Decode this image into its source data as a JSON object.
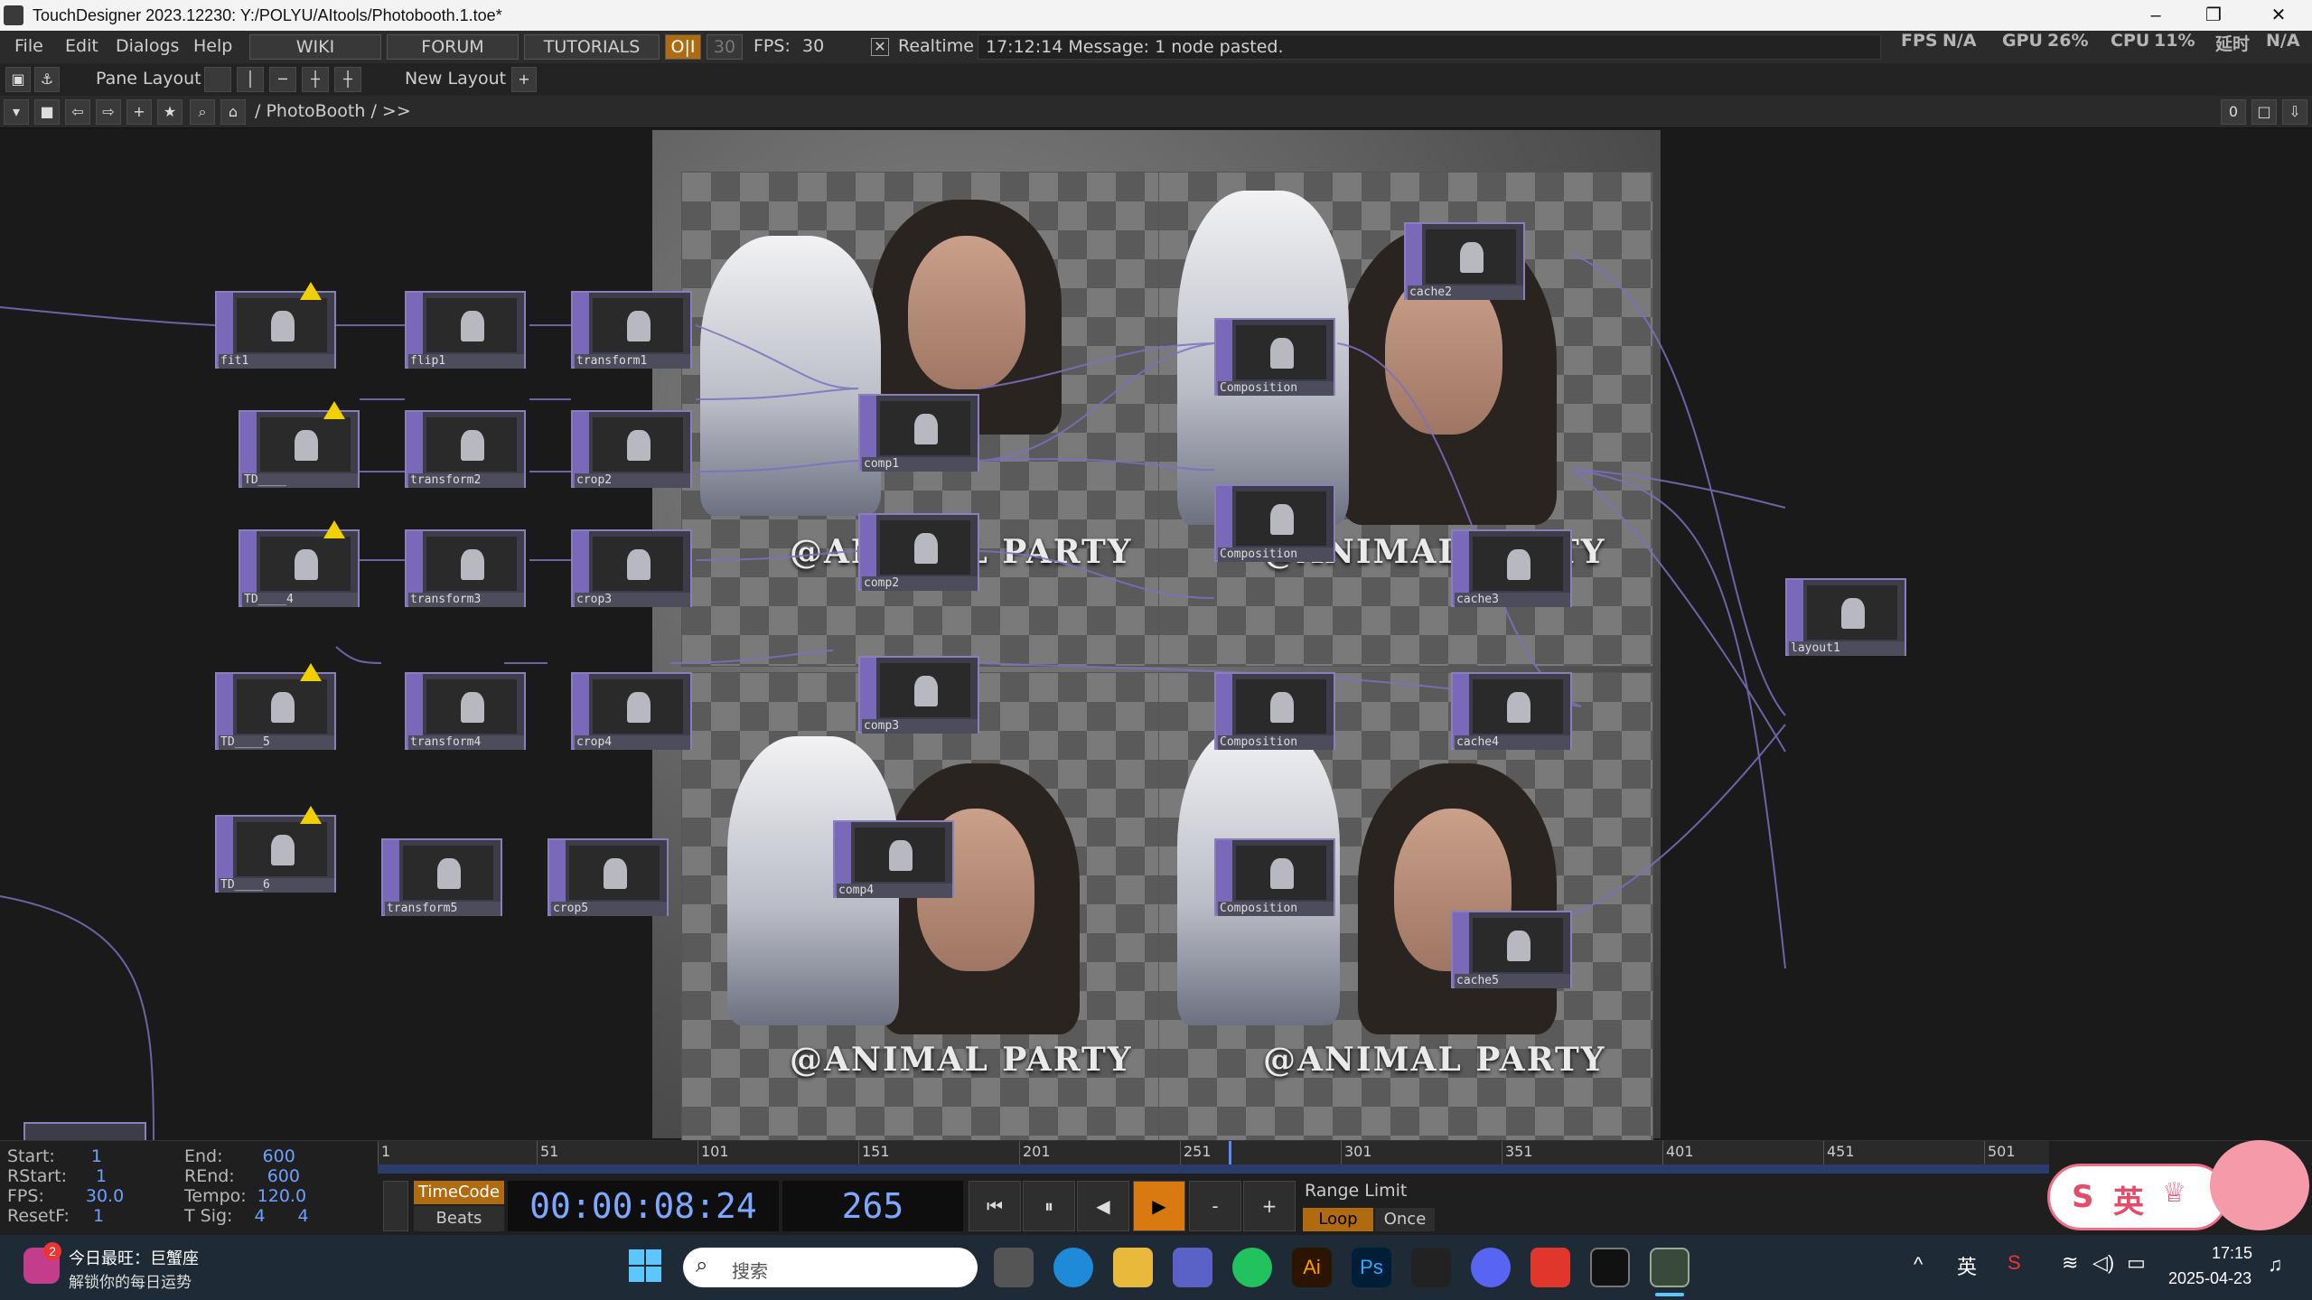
{
  "titlebar": {
    "title": "TouchDesigner 2023.12230: Y:/POLYU/AItools/Photobooth.1.toe*",
    "minimize": "–",
    "restore": "❐",
    "close": "✕"
  },
  "menubar": {
    "items": [
      "File",
      "Edit",
      "Dialogs",
      "Help"
    ],
    "wiki": "WIKI",
    "forum": "FORUM",
    "tutorials": "TUTORIALS",
    "oi": "O|I",
    "fps_box": "30",
    "fps_label": "FPS:",
    "fps_value": "30",
    "realtime_check": "✕",
    "realtime_label": "Realtime",
    "message": "17:12:14 Message: 1 node pasted.",
    "stats": {
      "fps_label": "FPS",
      "fps_value": "N/A",
      "gpu_label": "GPU",
      "gpu_value": "26%",
      "cpu_label": "CPU",
      "cpu_value": "11%",
      "lat_label": "延时",
      "lat_value": "N/A"
    }
  },
  "panebar": {
    "pane_layout": "Pane Layout",
    "new_layout": "New Layout",
    "add": "+"
  },
  "pathbar": {
    "path": "/ PhotoBooth / >>",
    "counter": "0"
  },
  "watermark": "@ANIMAL PARTY",
  "nodes": {
    "fit1": "fit1",
    "flip1": "flip1",
    "transform1": "transform1",
    "td_a": "TD____",
    "transform2": "transform2",
    "crop2": "crop2",
    "td_4": "TD____4",
    "transform3": "transform3",
    "crop3": "crop3",
    "td_5": "TD____5",
    "transform4": "transform4",
    "crop4": "crop4",
    "td_6": "TD____6",
    "transform5": "transform5",
    "crop5": "crop5",
    "comp1": "comp1",
    "comp2": "comp2",
    "comp3": "comp3",
    "comp4": "comp4",
    "composition1": "Composition",
    "composition2": "Composition",
    "composition3": "Composition",
    "composition4": "Composition",
    "cache2": "cache2",
    "cache3": "cache3",
    "cache4": "cache4",
    "cache5": "cache5",
    "layout1": "layout1"
  },
  "timeline": {
    "start_label": "Start:",
    "start": "1",
    "rstart_label": "RStart:",
    "rstart": "1",
    "fps_label": "FPS:",
    "fps": "30.0",
    "resetf_label": "ResetF:",
    "resetf": "1",
    "end_label": "End:",
    "end": "600",
    "rend_label": "REnd:",
    "rend": "600",
    "tempo_label": "Tempo:",
    "tempo": "120.0",
    "tsig_label": "T Sig:",
    "tsig_a": "4",
    "tsig_b": "4",
    "ruler_marks": [
      "1",
      "51",
      "101",
      "151",
      "201",
      "251",
      "301",
      "351",
      "401",
      "451",
      "501"
    ],
    "timecode_btn": "TimeCode",
    "beats_btn": "Beats",
    "timecode": "00:00:08:24",
    "frame": "265",
    "range_limit": "Range Limit",
    "loop": "Loop",
    "once": "Once",
    "btn_minus": "-",
    "btn_plus": "+"
  },
  "taskbar": {
    "notif_badge": "2",
    "widget_title": "今日最旺：巨蟹座",
    "widget_sub": "解锁你的每日运势",
    "search_placeholder": "搜索",
    "ime": "英",
    "time": "17:15",
    "date": "2025-04-23",
    "ai_label": "Ai",
    "ps_label": "Ps"
  },
  "ime_widget": {
    "s": "S",
    "text": "英"
  }
}
